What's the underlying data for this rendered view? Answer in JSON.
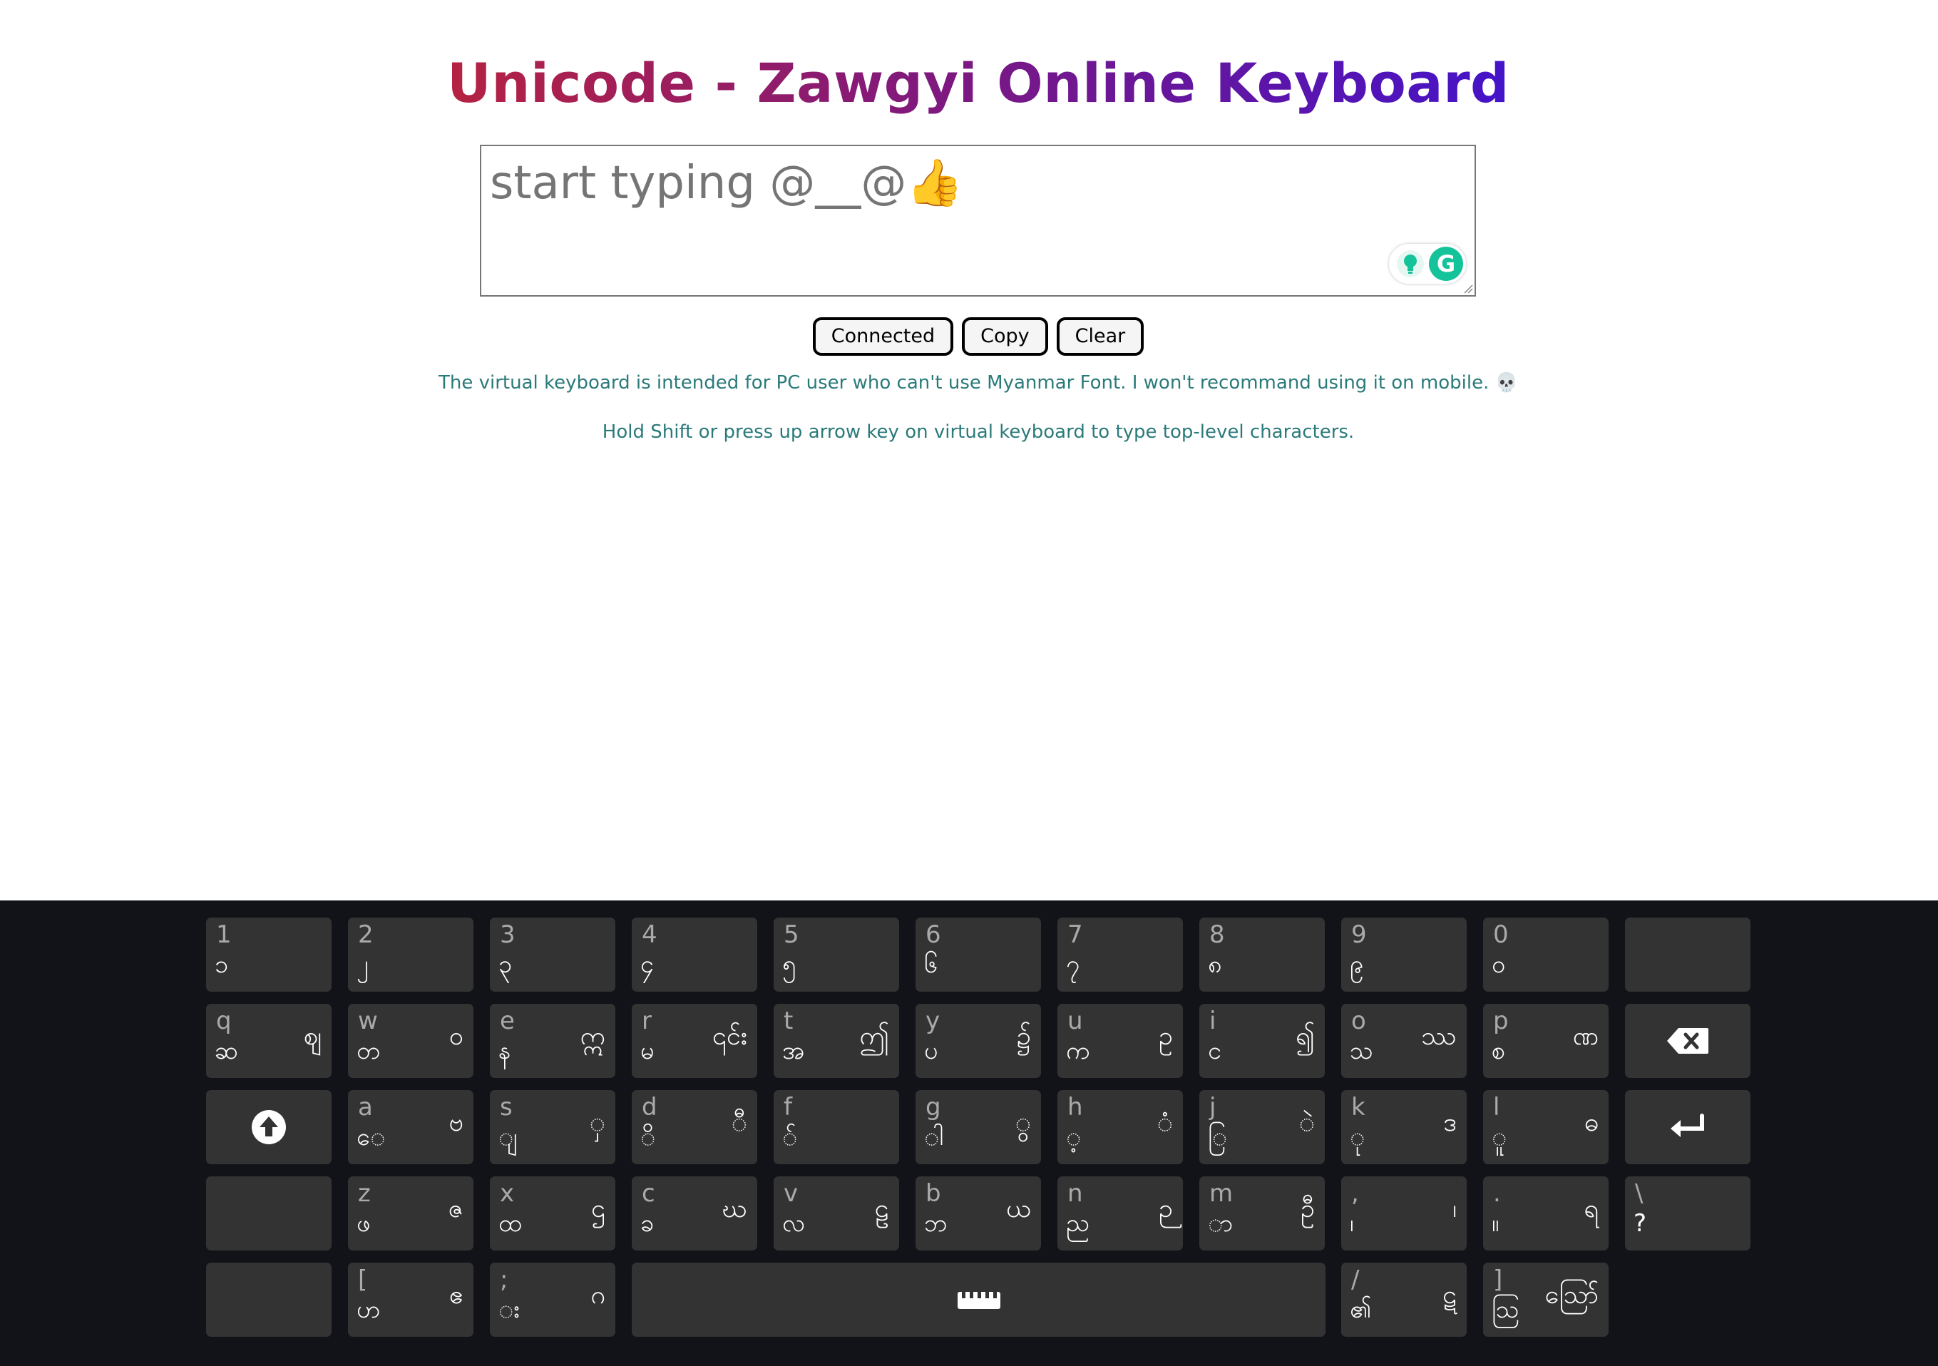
{
  "title": "Unicode - Zawgyi Online Keyboard",
  "editor": {
    "placeholder": "start typing @__@👍"
  },
  "buttons": {
    "connected": "Connected",
    "copy": "Copy",
    "clear": "Clear"
  },
  "info": {
    "line1": "The virtual keyboard is intended for PC user who can't use Myanmar Font. I won't recommand using it on mobile. 💀",
    "line2": "Hold Shift or press up arrow key on virtual keyboard to type top-level characters."
  },
  "keyboard": {
    "row1": [
      {
        "lat": "1",
        "low": "၁",
        "top": ""
      },
      {
        "lat": "2",
        "low": "၂",
        "top": ""
      },
      {
        "lat": "3",
        "low": "၃",
        "top": ""
      },
      {
        "lat": "4",
        "low": "၄",
        "top": ""
      },
      {
        "lat": "5",
        "low": "၅",
        "top": ""
      },
      {
        "lat": "6",
        "low": "၆",
        "top": ""
      },
      {
        "lat": "7",
        "low": "၇",
        "top": ""
      },
      {
        "lat": "8",
        "low": "၈",
        "top": ""
      },
      {
        "lat": "9",
        "low": "၉",
        "top": ""
      },
      {
        "lat": "0",
        "low": "၀",
        "top": ""
      },
      {
        "lat": "",
        "low": "",
        "top": ""
      }
    ],
    "row2": [
      {
        "lat": "q",
        "low": "ဆ",
        "top": "ဈ"
      },
      {
        "lat": "w",
        "low": "တ",
        "top": "ဝ"
      },
      {
        "lat": "e",
        "low": "န",
        "top": "ဣ"
      },
      {
        "lat": "r",
        "low": "မ",
        "top": "၎င်း"
      },
      {
        "lat": "t",
        "low": "အ",
        "top": "ဤ"
      },
      {
        "lat": "y",
        "low": "ပ",
        "top": "၌"
      },
      {
        "lat": "u",
        "low": "က",
        "top": "ဥ"
      },
      {
        "lat": "i",
        "low": "င",
        "top": "၍"
      },
      {
        "lat": "o",
        "low": "သ",
        "top": "ဿ"
      },
      {
        "lat": "p",
        "low": "စ",
        "top": "ဏ"
      }
    ],
    "row3": [
      {
        "lat": "a",
        "low": "ေ",
        "top": "ဗ"
      },
      {
        "lat": "s",
        "low": "ျ",
        "top": "ှ"
      },
      {
        "lat": "d",
        "low": "ိ",
        "top": "ီ"
      },
      {
        "lat": "f",
        "low": "်",
        "top": ""
      },
      {
        "lat": "g",
        "low": "ါ",
        "top": "ွ"
      },
      {
        "lat": "h",
        "low": "့",
        "top": "ံ"
      },
      {
        "lat": "j",
        "low": "ြ",
        "top": "ဲ"
      },
      {
        "lat": "k",
        "low": "ု",
        "top": "ဒ"
      },
      {
        "lat": "l",
        "low": "ူ",
        "top": "ဓ"
      }
    ],
    "row4": [
      {
        "lat": "z",
        "low": "ဖ",
        "top": "ဇ"
      },
      {
        "lat": "x",
        "low": "ထ",
        "top": "ဌ"
      },
      {
        "lat": "c",
        "low": "ခ",
        "top": "ဃ"
      },
      {
        "lat": "v",
        "low": "လ",
        "top": "ဠ"
      },
      {
        "lat": "b",
        "low": "ဘ",
        "top": "ယ"
      },
      {
        "lat": "n",
        "low": "ည",
        "top": "ဉ"
      },
      {
        "lat": "m",
        "low": "ာ",
        "top": "ဦ"
      },
      {
        "lat": ",",
        "low": "၊",
        "top": "၊"
      },
      {
        "lat": ".",
        "low": "။",
        "top": "ရ"
      },
      {
        "lat": "\\",
        "low": "?",
        "top": ""
      }
    ],
    "row5": [
      {
        "lat": "[",
        "low": "ဟ",
        "top": "ဧ"
      },
      {
        "lat": ";",
        "low": "း",
        "top": "ဂ"
      },
      {
        "lat": "/",
        "low": "၏",
        "top": "ဋ"
      },
      {
        "lat": "]",
        "low": "ဩ",
        "top": "ဪ"
      }
    ],
    "icons": {
      "backspace": "backspace-icon",
      "shift": "shift-icon",
      "enter": "enter-icon",
      "space": "keyboard-icon"
    }
  }
}
